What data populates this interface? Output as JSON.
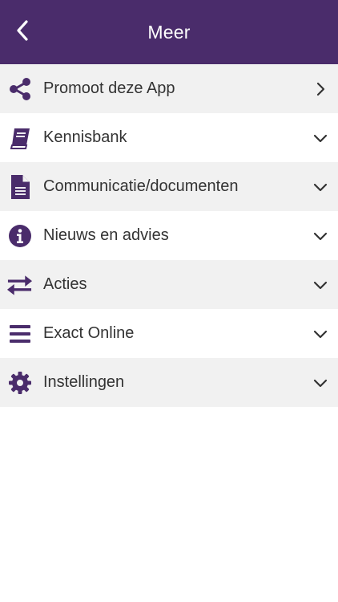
{
  "header": {
    "title": "Meer",
    "back_icon": "chevron-left-icon"
  },
  "colors": {
    "header_bg": "#4a2c6b",
    "icon": "#4a2c6b",
    "row_shaded": "#f1f1f1",
    "text": "#333333"
  },
  "menu": {
    "items": [
      {
        "label": "Promoot deze App",
        "icon": "share-icon",
        "indicator": "chevron-right-icon"
      },
      {
        "label": "Kennisbank",
        "icon": "book-icon",
        "indicator": "chevron-down-icon"
      },
      {
        "label": "Communicatie/documenten",
        "icon": "document-icon",
        "indicator": "chevron-down-icon"
      },
      {
        "label": "Nieuws en advies",
        "icon": "info-icon",
        "indicator": "chevron-down-icon"
      },
      {
        "label": "Acties",
        "icon": "exchange-arrows-icon",
        "indicator": "chevron-down-icon"
      },
      {
        "label": "Exact Online",
        "icon": "menu-bars-icon",
        "indicator": "chevron-down-icon"
      },
      {
        "label": "Instellingen",
        "icon": "gear-icon",
        "indicator": "chevron-down-icon"
      }
    ]
  }
}
